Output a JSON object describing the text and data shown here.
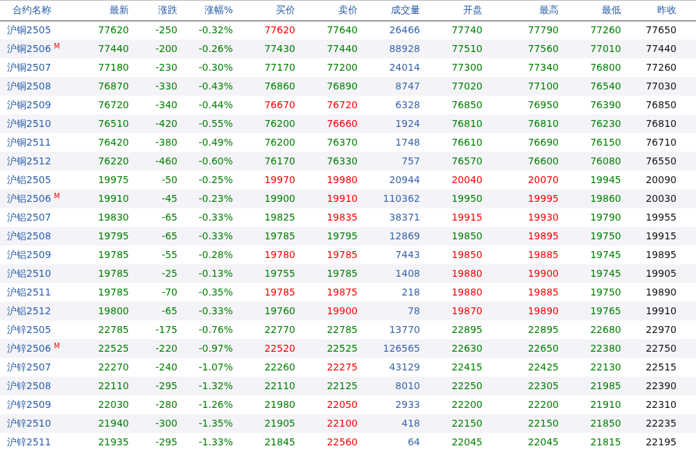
{
  "columns": [
    {
      "label": "合约名称",
      "kind": "name"
    },
    {
      "label": "最新",
      "kind": "price"
    },
    {
      "label": "涨跌",
      "kind": "price"
    },
    {
      "label": "涨幅%",
      "kind": "price"
    },
    {
      "label": "买价",
      "kind": "price"
    },
    {
      "label": "卖价",
      "kind": "price"
    },
    {
      "label": "成交量",
      "kind": "volume"
    },
    {
      "label": "开盘",
      "kind": "price"
    },
    {
      "label": "最高",
      "kind": "price"
    },
    {
      "label": "最低",
      "kind": "price"
    },
    {
      "label": "昨收",
      "kind": "plain"
    }
  ],
  "rows": [
    {
      "name": "沪铜2505",
      "cells": [
        {
          "text": "77620",
          "color": "#008000"
        },
        {
          "text": "-250",
          "color": "#008000"
        },
        {
          "text": "-0.32%",
          "color": "#008000"
        },
        {
          "text": "77620",
          "color": "#ff0000"
        },
        {
          "text": "77640",
          "color": "#008000"
        },
        {
          "text": "26466"
        },
        {
          "text": "77740",
          "color": "#008000"
        },
        {
          "text": "77790",
          "color": "#008000"
        },
        {
          "text": "77260",
          "color": "#008000"
        },
        {
          "text": "77650"
        }
      ]
    },
    {
      "name": "沪铜2506",
      "badge": "M",
      "cells": [
        {
          "text": "77440",
          "color": "#008000"
        },
        {
          "text": "-200",
          "color": "#008000"
        },
        {
          "text": "-0.26%",
          "color": "#008000"
        },
        {
          "text": "77430",
          "color": "#008000"
        },
        {
          "text": "77440",
          "color": "#008000"
        },
        {
          "text": "88928"
        },
        {
          "text": "77510",
          "color": "#008000"
        },
        {
          "text": "77560",
          "color": "#008000"
        },
        {
          "text": "77010",
          "color": "#008000"
        },
        {
          "text": "77440"
        }
      ]
    },
    {
      "name": "沪铜2507",
      "cells": [
        {
          "text": "77180",
          "color": "#008000"
        },
        {
          "text": "-230",
          "color": "#008000"
        },
        {
          "text": "-0.30%",
          "color": "#008000"
        },
        {
          "text": "77170",
          "color": "#008000"
        },
        {
          "text": "77200",
          "color": "#008000"
        },
        {
          "text": "24014"
        },
        {
          "text": "77300",
          "color": "#008000"
        },
        {
          "text": "77340",
          "color": "#008000"
        },
        {
          "text": "76800",
          "color": "#008000"
        },
        {
          "text": "77260"
        }
      ]
    },
    {
      "name": "沪铜2508",
      "cells": [
        {
          "text": "76870",
          "color": "#008000"
        },
        {
          "text": "-330",
          "color": "#008000"
        },
        {
          "text": "-0.43%",
          "color": "#008000"
        },
        {
          "text": "76860",
          "color": "#008000"
        },
        {
          "text": "76890",
          "color": "#008000"
        },
        {
          "text": "8747"
        },
        {
          "text": "77020",
          "color": "#008000"
        },
        {
          "text": "77100",
          "color": "#008000"
        },
        {
          "text": "76540",
          "color": "#008000"
        },
        {
          "text": "77030"
        }
      ]
    },
    {
      "name": "沪铜2509",
      "cells": [
        {
          "text": "76720",
          "color": "#008000"
        },
        {
          "text": "-340",
          "color": "#008000"
        },
        {
          "text": "-0.44%",
          "color": "#008000"
        },
        {
          "text": "76670",
          "color": "#ff0000"
        },
        {
          "text": "76720",
          "color": "#ff0000"
        },
        {
          "text": "6328"
        },
        {
          "text": "76850",
          "color": "#008000"
        },
        {
          "text": "76950",
          "color": "#008000"
        },
        {
          "text": "76390",
          "color": "#008000"
        },
        {
          "text": "76850"
        }
      ]
    },
    {
      "name": "沪铜2510",
      "cells": [
        {
          "text": "76510",
          "color": "#008000"
        },
        {
          "text": "-420",
          "color": "#008000"
        },
        {
          "text": "-0.55%",
          "color": "#008000"
        },
        {
          "text": "76200",
          "color": "#008000"
        },
        {
          "text": "76660",
          "color": "#ff0000"
        },
        {
          "text": "1924"
        },
        {
          "text": "76810",
          "color": "#008000"
        },
        {
          "text": "76810",
          "color": "#008000"
        },
        {
          "text": "76230",
          "color": "#008000"
        },
        {
          "text": "76810"
        }
      ]
    },
    {
      "name": "沪铜2511",
      "cells": [
        {
          "text": "76420",
          "color": "#008000"
        },
        {
          "text": "-380",
          "color": "#008000"
        },
        {
          "text": "-0.49%",
          "color": "#008000"
        },
        {
          "text": "76200",
          "color": "#008000"
        },
        {
          "text": "76370",
          "color": "#008000"
        },
        {
          "text": "1748"
        },
        {
          "text": "76610",
          "color": "#008000"
        },
        {
          "text": "76690",
          "color": "#008000"
        },
        {
          "text": "76150",
          "color": "#008000"
        },
        {
          "text": "76710"
        }
      ]
    },
    {
      "name": "沪铜2512",
      "cells": [
        {
          "text": "76220",
          "color": "#008000"
        },
        {
          "text": "-460",
          "color": "#008000"
        },
        {
          "text": "-0.60%",
          "color": "#008000"
        },
        {
          "text": "76170",
          "color": "#008000"
        },
        {
          "text": "76330",
          "color": "#008000"
        },
        {
          "text": "757"
        },
        {
          "text": "76570",
          "color": "#008000"
        },
        {
          "text": "76600",
          "color": "#008000"
        },
        {
          "text": "76080",
          "color": "#008000"
        },
        {
          "text": "76550"
        }
      ]
    },
    {
      "name": "沪铝2505",
      "cells": [
        {
          "text": "19975",
          "color": "#008000"
        },
        {
          "text": "-50",
          "color": "#008000"
        },
        {
          "text": "-0.25%",
          "color": "#008000"
        },
        {
          "text": "19970",
          "color": "#ff0000"
        },
        {
          "text": "19980",
          "color": "#ff0000"
        },
        {
          "text": "20944"
        },
        {
          "text": "20040",
          "color": "#ff0000"
        },
        {
          "text": "20070",
          "color": "#ff0000"
        },
        {
          "text": "19945",
          "color": "#008000"
        },
        {
          "text": "20090"
        }
      ]
    },
    {
      "name": "沪铝2506",
      "badge": "M",
      "cells": [
        {
          "text": "19910",
          "color": "#008000"
        },
        {
          "text": "-45",
          "color": "#008000"
        },
        {
          "text": "-0.23%",
          "color": "#008000"
        },
        {
          "text": "19900",
          "color": "#008000"
        },
        {
          "text": "19910",
          "color": "#ff0000"
        },
        {
          "text": "110362"
        },
        {
          "text": "19950",
          "color": "#008000"
        },
        {
          "text": "19995",
          "color": "#ff0000"
        },
        {
          "text": "19860",
          "color": "#008000"
        },
        {
          "text": "20030"
        }
      ]
    },
    {
      "name": "沪铝2507",
      "cells": [
        {
          "text": "19830",
          "color": "#008000"
        },
        {
          "text": "-65",
          "color": "#008000"
        },
        {
          "text": "-0.33%",
          "color": "#008000"
        },
        {
          "text": "19825",
          "color": "#008000"
        },
        {
          "text": "19835",
          "color": "#ff0000"
        },
        {
          "text": "38371"
        },
        {
          "text": "19915",
          "color": "#ff0000"
        },
        {
          "text": "19930",
          "color": "#ff0000"
        },
        {
          "text": "19790",
          "color": "#008000"
        },
        {
          "text": "19955"
        }
      ]
    },
    {
      "name": "沪铝2508",
      "cells": [
        {
          "text": "19795",
          "color": "#008000"
        },
        {
          "text": "-65",
          "color": "#008000"
        },
        {
          "text": "-0.33%",
          "color": "#008000"
        },
        {
          "text": "19785",
          "color": "#008000"
        },
        {
          "text": "19795",
          "color": "#008000"
        },
        {
          "text": "12869"
        },
        {
          "text": "19850",
          "color": "#008000"
        },
        {
          "text": "19895",
          "color": "#ff0000"
        },
        {
          "text": "19750",
          "color": "#008000"
        },
        {
          "text": "19915"
        }
      ]
    },
    {
      "name": "沪铝2509",
      "cells": [
        {
          "text": "19785",
          "color": "#008000"
        },
        {
          "text": "-55",
          "color": "#008000"
        },
        {
          "text": "-0.28%",
          "color": "#008000"
        },
        {
          "text": "19780",
          "color": "#ff0000"
        },
        {
          "text": "19785",
          "color": "#ff0000"
        },
        {
          "text": "7443"
        },
        {
          "text": "19850",
          "color": "#ff0000"
        },
        {
          "text": "19885",
          "color": "#ff0000"
        },
        {
          "text": "19745",
          "color": "#008000"
        },
        {
          "text": "19895"
        }
      ]
    },
    {
      "name": "沪铝2510",
      "cells": [
        {
          "text": "19785",
          "color": "#008000"
        },
        {
          "text": "-25",
          "color": "#008000"
        },
        {
          "text": "-0.13%",
          "color": "#008000"
        },
        {
          "text": "19755",
          "color": "#008000"
        },
        {
          "text": "19785",
          "color": "#008000"
        },
        {
          "text": "1408"
        },
        {
          "text": "19880",
          "color": "#ff0000"
        },
        {
          "text": "19900",
          "color": "#ff0000"
        },
        {
          "text": "19745",
          "color": "#008000"
        },
        {
          "text": "19905"
        }
      ]
    },
    {
      "name": "沪铝2511",
      "cells": [
        {
          "text": "19785",
          "color": "#008000"
        },
        {
          "text": "-70",
          "color": "#008000"
        },
        {
          "text": "-0.35%",
          "color": "#008000"
        },
        {
          "text": "19785",
          "color": "#ff0000"
        },
        {
          "text": "19875",
          "color": "#ff0000"
        },
        {
          "text": "218"
        },
        {
          "text": "19880",
          "color": "#ff0000"
        },
        {
          "text": "19885",
          "color": "#ff0000"
        },
        {
          "text": "19750",
          "color": "#008000"
        },
        {
          "text": "19890"
        }
      ]
    },
    {
      "name": "沪铝2512",
      "cells": [
        {
          "text": "19800",
          "color": "#008000"
        },
        {
          "text": "-65",
          "color": "#008000"
        },
        {
          "text": "-0.33%",
          "color": "#008000"
        },
        {
          "text": "19760",
          "color": "#008000"
        },
        {
          "text": "19900",
          "color": "#ff0000"
        },
        {
          "text": "78"
        },
        {
          "text": "19870",
          "color": "#ff0000"
        },
        {
          "text": "19890",
          "color": "#ff0000"
        },
        {
          "text": "19765",
          "color": "#008000"
        },
        {
          "text": "19910"
        }
      ]
    },
    {
      "name": "沪锌2505",
      "cells": [
        {
          "text": "22785",
          "color": "#008000"
        },
        {
          "text": "-175",
          "color": "#008000"
        },
        {
          "text": "-0.76%",
          "color": "#008000"
        },
        {
          "text": "22770",
          "color": "#008000"
        },
        {
          "text": "22785",
          "color": "#008000"
        },
        {
          "text": "13770"
        },
        {
          "text": "22895",
          "color": "#008000"
        },
        {
          "text": "22895",
          "color": "#008000"
        },
        {
          "text": "22680",
          "color": "#008000"
        },
        {
          "text": "22970"
        }
      ]
    },
    {
      "name": "沪锌2506",
      "badge": "M",
      "cells": [
        {
          "text": "22525",
          "color": "#008000"
        },
        {
          "text": "-220",
          "color": "#008000"
        },
        {
          "text": "-0.97%",
          "color": "#008000"
        },
        {
          "text": "22520",
          "color": "#ff0000"
        },
        {
          "text": "22525",
          "color": "#008000"
        },
        {
          "text": "126565"
        },
        {
          "text": "22630",
          "color": "#008000"
        },
        {
          "text": "22650",
          "color": "#008000"
        },
        {
          "text": "22380",
          "color": "#008000"
        },
        {
          "text": "22750"
        }
      ]
    },
    {
      "name": "沪锌2507",
      "cells": [
        {
          "text": "22270",
          "color": "#008000"
        },
        {
          "text": "-240",
          "color": "#008000"
        },
        {
          "text": "-1.07%",
          "color": "#008000"
        },
        {
          "text": "22260",
          "color": "#008000"
        },
        {
          "text": "22275",
          "color": "#ff0000"
        },
        {
          "text": "43129"
        },
        {
          "text": "22415",
          "color": "#008000"
        },
        {
          "text": "22425",
          "color": "#008000"
        },
        {
          "text": "22130",
          "color": "#008000"
        },
        {
          "text": "22515"
        }
      ]
    },
    {
      "name": "沪锌2508",
      "cells": [
        {
          "text": "22110",
          "color": "#008000"
        },
        {
          "text": "-295",
          "color": "#008000"
        },
        {
          "text": "-1.32%",
          "color": "#008000"
        },
        {
          "text": "22110",
          "color": "#008000"
        },
        {
          "text": "22125",
          "color": "#008000"
        },
        {
          "text": "8010"
        },
        {
          "text": "22250",
          "color": "#008000"
        },
        {
          "text": "22305",
          "color": "#008000"
        },
        {
          "text": "21985",
          "color": "#008000"
        },
        {
          "text": "22390"
        }
      ]
    },
    {
      "name": "沪锌2509",
      "cells": [
        {
          "text": "22030",
          "color": "#008000"
        },
        {
          "text": "-280",
          "color": "#008000"
        },
        {
          "text": "-1.26%",
          "color": "#008000"
        },
        {
          "text": "21980",
          "color": "#008000"
        },
        {
          "text": "22050",
          "color": "#ff0000"
        },
        {
          "text": "2933"
        },
        {
          "text": "22200",
          "color": "#008000"
        },
        {
          "text": "22200",
          "color": "#008000"
        },
        {
          "text": "21910",
          "color": "#008000"
        },
        {
          "text": "22310"
        }
      ]
    },
    {
      "name": "沪锌2510",
      "cells": [
        {
          "text": "21940",
          "color": "#008000"
        },
        {
          "text": "-300",
          "color": "#008000"
        },
        {
          "text": "-1.35%",
          "color": "#008000"
        },
        {
          "text": "21905",
          "color": "#008000"
        },
        {
          "text": "22100",
          "color": "#ff0000"
        },
        {
          "text": "418"
        },
        {
          "text": "22150",
          "color": "#008000"
        },
        {
          "text": "22150",
          "color": "#008000"
        },
        {
          "text": "21850",
          "color": "#008000"
        },
        {
          "text": "22235"
        }
      ]
    },
    {
      "name": "沪锌2511",
      "cells": [
        {
          "text": "21935",
          "color": "#008000"
        },
        {
          "text": "-295",
          "color": "#008000"
        },
        {
          "text": "-1.33%",
          "color": "#008000"
        },
        {
          "text": "21845",
          "color": "#008000"
        },
        {
          "text": "22560",
          "color": "#ff0000"
        },
        {
          "text": "64"
        },
        {
          "text": "22045",
          "color": "#008000"
        },
        {
          "text": "22045",
          "color": "#008000"
        },
        {
          "text": "21815",
          "color": "#008000"
        },
        {
          "text": "22195"
        }
      ]
    }
  ]
}
